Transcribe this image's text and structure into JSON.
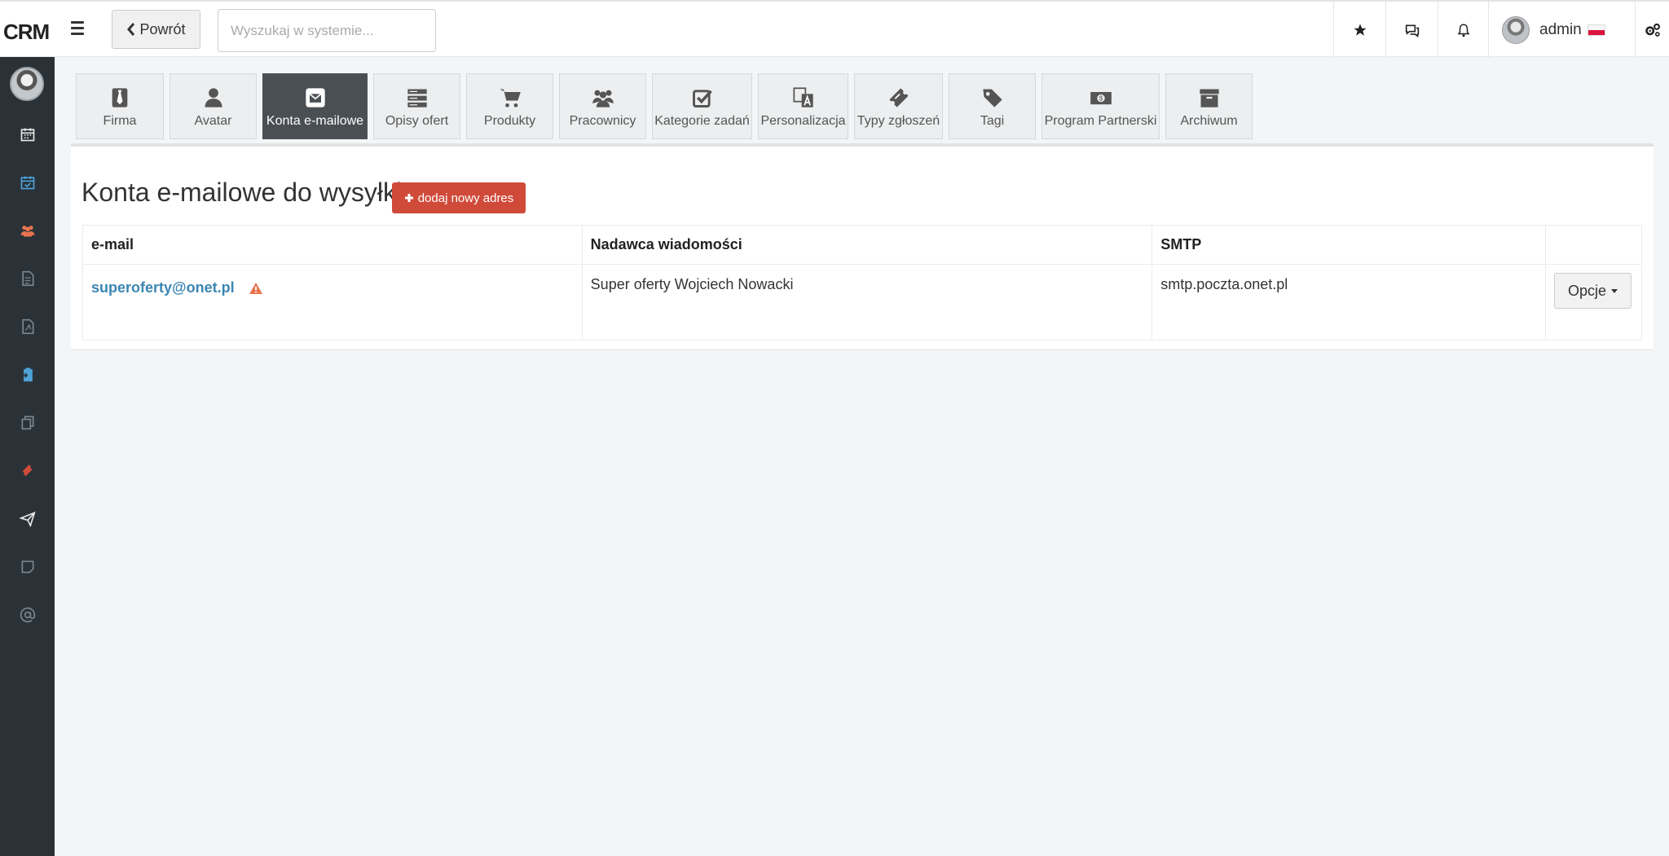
{
  "app": {
    "logo": "CRM"
  },
  "topbar": {
    "back_label": "Powrót",
    "search_placeholder": "Wyszukaj w systemie...",
    "username": "admin"
  },
  "tabs": [
    {
      "label": "Firma",
      "icon": "tie-icon",
      "active": false
    },
    {
      "label": "Avatar",
      "icon": "user-icon",
      "active": false
    },
    {
      "label": "Konta e-mailowe",
      "icon": "envelope-icon",
      "active": true
    },
    {
      "label": "Opisy ofert",
      "icon": "server-list-icon",
      "active": false
    },
    {
      "label": "Produkty",
      "icon": "cart-icon",
      "active": false
    },
    {
      "label": "Pracownicy",
      "icon": "users-icon",
      "active": false
    },
    {
      "label": "Kategorie zadań",
      "icon": "checkbox-icon",
      "active": false
    },
    {
      "label": "Personalizacja",
      "icon": "translate-icon",
      "active": false
    },
    {
      "label": "Typy zgłoszeń",
      "icon": "ticket-icon",
      "active": false
    },
    {
      "label": "Tagi",
      "icon": "tags-icon",
      "active": false
    },
    {
      "label": "Program Partnerski",
      "icon": "money-icon",
      "active": false
    },
    {
      "label": "Archiwum",
      "icon": "archive-icon",
      "active": false
    }
  ],
  "main": {
    "title": "Konta e-mailowe do wysyłki",
    "add_button": "dodaj nowy adres",
    "table": {
      "headers": [
        "e-mail",
        "Nadawca wiadomości",
        "SMTP",
        ""
      ],
      "rows": [
        {
          "email": "superoferty@onet.pl",
          "sender": "Super oferty Wojciech Nowacki",
          "smtp": "smtp.poczta.onet.pl",
          "options_label": "Opcje"
        }
      ]
    }
  },
  "colors": {
    "sidebar_bg": "#2a3238",
    "accent_red": "#d04a3a",
    "link_blue": "#3c86b3",
    "active_tab": "#4a4f54"
  }
}
